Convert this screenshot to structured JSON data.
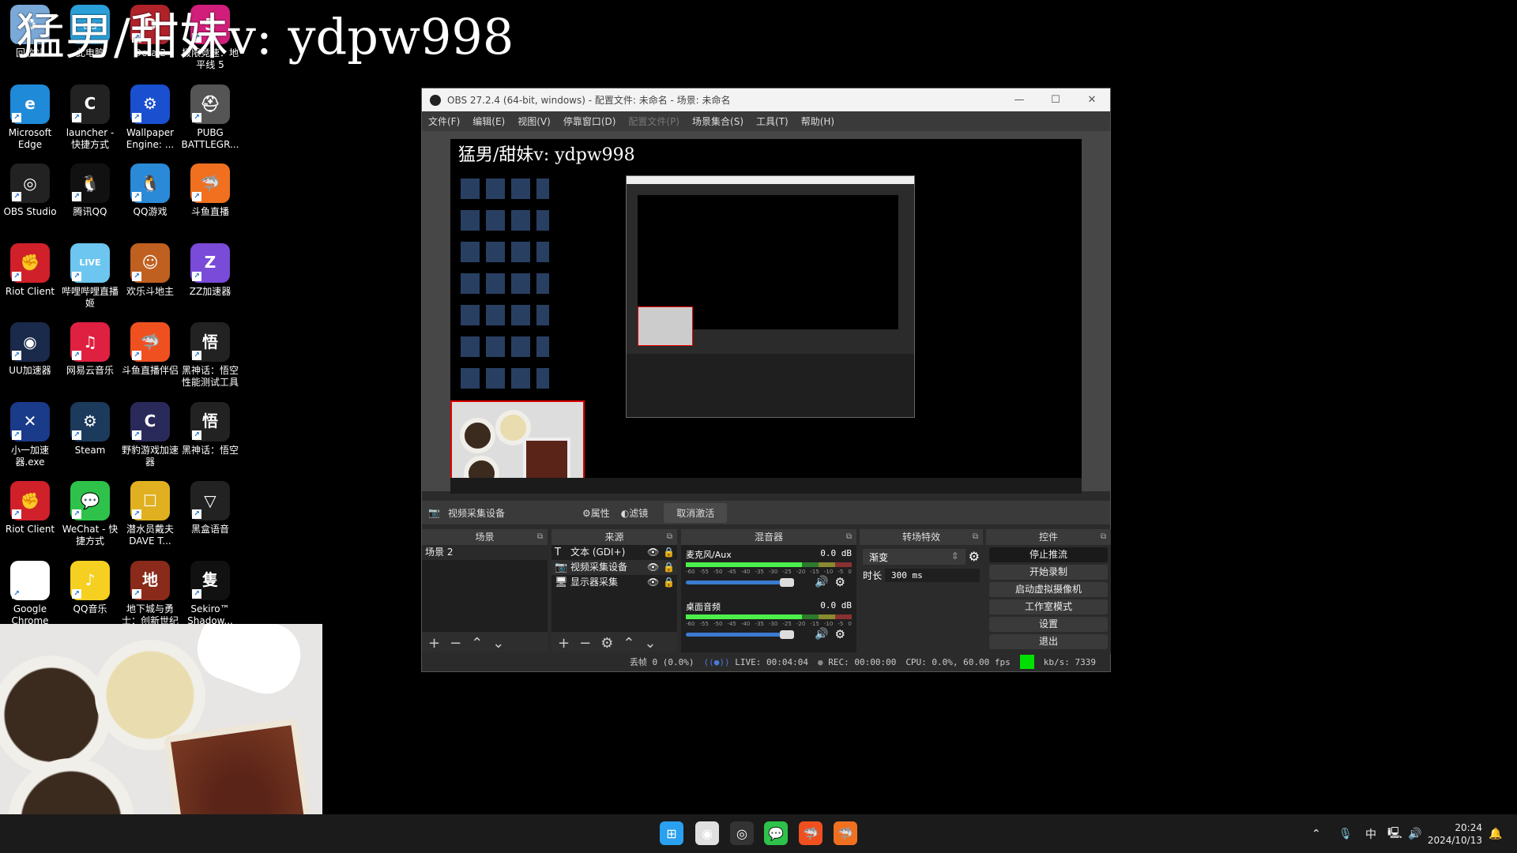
{
  "watermark": "猛男/甜妹v: ydpw998",
  "desktop": {
    "icons": [
      {
        "label": "回收站",
        "color": "#7aa9d8",
        "glyph": "♻"
      },
      {
        "label": "此电脑",
        "color": "#2a9fd8",
        "glyph": "▭"
      },
      {
        "label": "Dota 2",
        "color": "#b0222a",
        "glyph": "D"
      },
      {
        "label": "极限竞速：地平线 5",
        "color": "#d01e7a",
        "glyph": "5"
      },
      {
        "label": "Microsoft Edge",
        "color": "#1f8ad8",
        "glyph": "e"
      },
      {
        "label": "launcher - 快捷方式",
        "color": "#222",
        "glyph": "C"
      },
      {
        "label": "Wallpaper Engine: ...",
        "color": "#1a4fd0",
        "glyph": "⚙"
      },
      {
        "label": "PUBG BATTLEGR...",
        "color": "#555",
        "glyph": "⛑"
      },
      {
        "label": "OBS Studio",
        "color": "#222",
        "glyph": "◎"
      },
      {
        "label": "腾讯QQ",
        "color": "#111",
        "glyph": "🐧"
      },
      {
        "label": "QQ游戏",
        "color": "#2a8ad8",
        "glyph": "🐧"
      },
      {
        "label": "斗鱼直播",
        "color": "#f07020",
        "glyph": "🦈"
      },
      {
        "label": "Riot Client",
        "color": "#d0202a",
        "glyph": "✊"
      },
      {
        "label": "哔哩哔哩直播姬",
        "color": "#6cc6f0",
        "glyph": "LIVE"
      },
      {
        "label": "欢乐斗地主",
        "color": "#c06020",
        "glyph": "☺"
      },
      {
        "label": "ZZ加速器",
        "color": "#7a4ad8",
        "glyph": "Z"
      },
      {
        "label": "UU加速器",
        "color": "#1a2a4a",
        "glyph": "◉"
      },
      {
        "label": "网易云音乐",
        "color": "#e02040",
        "glyph": "♫"
      },
      {
        "label": "斗鱼直播伴侣",
        "color": "#f05020",
        "glyph": "🦈"
      },
      {
        "label": "黑神话：悟空性能测试工具",
        "color": "#222",
        "glyph": "悟"
      },
      {
        "label": "小一加速器.exe",
        "color": "#1a3a8a",
        "glyph": "✕"
      },
      {
        "label": "Steam",
        "color": "#1b3a5c",
        "glyph": "⚙"
      },
      {
        "label": "野豹游戏加速器",
        "color": "#2a2a5a",
        "glyph": "C"
      },
      {
        "label": "黑神话：悟空",
        "color": "#222",
        "glyph": "悟"
      },
      {
        "label": "Riot Client",
        "color": "#d0202a",
        "glyph": "✊"
      },
      {
        "label": "WeChat - 快捷方式",
        "color": "#2ec24a",
        "glyph": "💬"
      },
      {
        "label": "潜水员戴夫 DAVE T...",
        "color": "#e0b020",
        "glyph": "☐"
      },
      {
        "label": "黑盒语音",
        "color": "#222",
        "glyph": "▽"
      },
      {
        "label": "Google Chrome",
        "color": "#fff",
        "glyph": "◉"
      },
      {
        "label": "QQ音乐",
        "color": "#f5d020",
        "glyph": "♪"
      },
      {
        "label": "地下城与勇士：创新世纪",
        "color": "#8a2a1a",
        "glyph": "地"
      },
      {
        "label": "Sekiro™ Shadow...",
        "color": "#111",
        "glyph": "隻"
      }
    ]
  },
  "obs": {
    "title": "OBS 27.2.4 (64-bit, windows) - 配置文件: 未命名 - 场景: 未命名",
    "window_buttons": [
      "—",
      "☐",
      "✕"
    ],
    "menu": [
      {
        "label": "文件(F)"
      },
      {
        "label": "编辑(E)"
      },
      {
        "label": "视图(V)"
      },
      {
        "label": "停靠窗口(D)"
      },
      {
        "label": "配置文件(P)",
        "disabled": true
      },
      {
        "label": "场景集合(S)"
      },
      {
        "label": "工具(T)"
      },
      {
        "label": "帮助(H)"
      }
    ],
    "preview_text": "猛男/甜妹v: ydpw998",
    "context": {
      "source": "视频采集设备",
      "properties": "属性",
      "filters": "滤镜",
      "deactivate": "取消激活"
    },
    "scenes": {
      "title": "场景",
      "items": [
        "场景 2"
      ]
    },
    "sources": {
      "title": "来源",
      "items": [
        {
          "label": "文本 (GDI+)",
          "icon": "T"
        },
        {
          "label": "视频采集设备",
          "icon": "📷"
        },
        {
          "label": "显示器采集",
          "icon": "🖥"
        }
      ]
    },
    "mixer": {
      "title": "混音器",
      "channels": [
        {
          "name": "麦克风/Aux",
          "db": "0.0 dB"
        },
        {
          "name": "桌面音频",
          "db": "0.0 dB"
        }
      ],
      "ticks": [
        "-60",
        "-55",
        "-50",
        "-45",
        "-40",
        "-35",
        "-30",
        "-25",
        "-20",
        "-15",
        "-10",
        "-5",
        "0"
      ]
    },
    "transitions": {
      "title": "转场特效",
      "selected": "渐变",
      "duration_label": "时长",
      "duration": "300 ms"
    },
    "controls": {
      "title": "控件",
      "buttons": [
        "停止推流",
        "开始录制",
        "启动虚拟摄像机",
        "工作室模式",
        "设置",
        "退出"
      ]
    },
    "status": {
      "dropped": "丢帧 0 (0.0%)",
      "live": "LIVE: 00:04:04",
      "rec": "REC: 00:00:00",
      "cpu": "CPU: 0.0%, 60.00 fps",
      "kbps": "kb/s: 7339",
      "indicator_color": "#00e000"
    }
  },
  "taskbar": {
    "apps": [
      {
        "name": "windows-start",
        "color": "#2aa0f0",
        "glyph": "⊞"
      },
      {
        "name": "chrome",
        "color": "#e0e0e0",
        "glyph": "◉"
      },
      {
        "name": "obs",
        "color": "#333",
        "glyph": "◎"
      },
      {
        "name": "wechat",
        "color": "#2ec24a",
        "glyph": "💬"
      },
      {
        "name": "douyu",
        "color": "#f05020",
        "glyph": "🦈"
      },
      {
        "name": "douyu-companion",
        "color": "#f07020",
        "glyph": "🦈"
      }
    ],
    "ime": "中",
    "time": "20:24",
    "date": "2024/10/13"
  }
}
